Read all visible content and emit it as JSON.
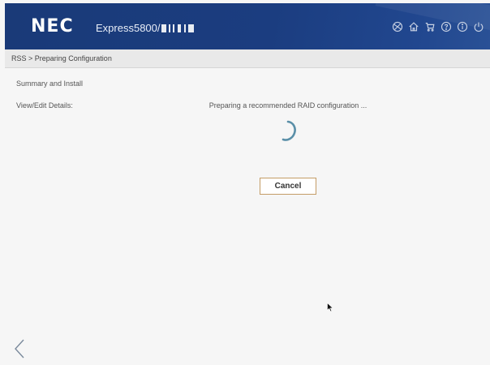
{
  "header": {
    "brand": "NEC",
    "model_prefix": "Express5800/",
    "toolbar_icons": [
      "globe-icon",
      "home-icon",
      "cart-icon",
      "help-icon",
      "info-icon",
      "power-icon"
    ]
  },
  "breadcrumb": "RSS > Preparing Configuration",
  "sidebar": {
    "items": [
      {
        "label": "Summary and Install"
      },
      {
        "label": "View/Edit Details:"
      }
    ]
  },
  "main": {
    "status": "Preparing a recommended RAID configuration ...",
    "cancel_label": "Cancel"
  },
  "colors": {
    "header_bg": "#1b3d80",
    "spinner": "#5a8fa8",
    "cancel_border": "#c49c66"
  }
}
